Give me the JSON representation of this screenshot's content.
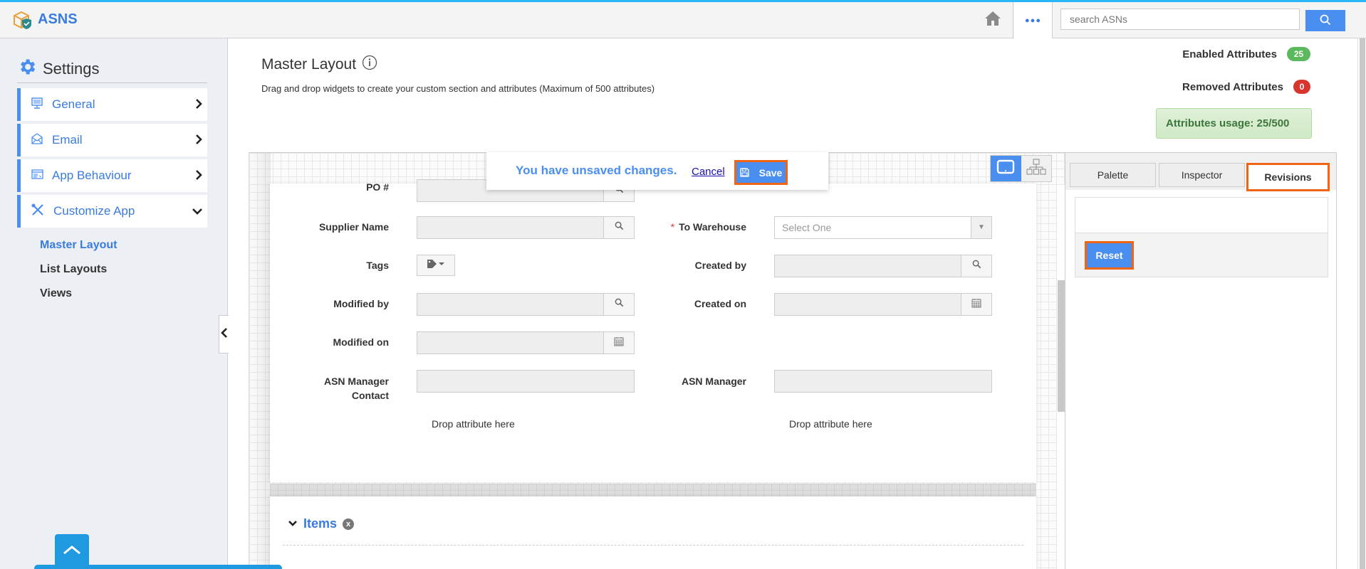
{
  "app": {
    "name": "ASNS"
  },
  "topbar": {
    "home_icon": "home-icon",
    "more_icon": "more-dots-icon",
    "more_label": "●●●",
    "search_placeholder": "search ASNs",
    "search_icon": "search-icon"
  },
  "sidebar": {
    "title": "Settings",
    "items": [
      {
        "label": "General",
        "icon": "monitor-icon",
        "expanded": false
      },
      {
        "label": "Email",
        "icon": "envelope-icon",
        "expanded": false
      },
      {
        "label": "App Behaviour",
        "icon": "app-window-icon",
        "expanded": false
      },
      {
        "label": "Customize App",
        "icon": "tools-icon",
        "expanded": true
      }
    ],
    "sub_items": [
      {
        "label": "Master Layout",
        "active": true
      },
      {
        "label": "List Layouts",
        "active": false
      },
      {
        "label": "Views",
        "active": false
      }
    ]
  },
  "header": {
    "title": "Master Layout",
    "description": "Drag and drop widgets to create your custom section and attributes (Maximum of 500 attributes)",
    "enabled_label": "Enabled Attributes",
    "enabled_count": "25",
    "removed_label": "Removed Attributes",
    "removed_count": "0",
    "usage_text": "Attributes usage: 25/500"
  },
  "notification": {
    "message": "You have unsaved changes.",
    "cancel_label": "Cancel",
    "save_label": "Save"
  },
  "form": {
    "fields": [
      {
        "label": "PO #",
        "type": "lookup"
      },
      {
        "label": "Supplier Name",
        "type": "lookup"
      },
      {
        "label": "To Warehouse",
        "type": "select",
        "required": true,
        "placeholder": "Select One"
      },
      {
        "label": "Tags",
        "type": "tags"
      },
      {
        "label": "Created by",
        "type": "lookup"
      },
      {
        "label": "Modified by",
        "type": "lookup"
      },
      {
        "label": "Created on",
        "type": "date"
      },
      {
        "label": "Modified on",
        "type": "date"
      },
      {
        "label": "ASN Manager Contact",
        "type": "text"
      },
      {
        "label": "ASN Manager",
        "type": "text"
      }
    ],
    "required_marker": "*",
    "drop_hint": "Drop attribute here"
  },
  "items_section": {
    "title": "Items",
    "remove_glyph": "x"
  },
  "right_panel": {
    "tabs": [
      {
        "label": "Palette",
        "active": false
      },
      {
        "label": "Inspector",
        "active": false
      },
      {
        "label": "Revisions",
        "active": true
      }
    ],
    "reset_label": "Reset"
  },
  "colors": {
    "accent": "#4a8ef0",
    "highlight": "#f06414",
    "success": "#5cb85c",
    "danger": "#d9352f"
  }
}
